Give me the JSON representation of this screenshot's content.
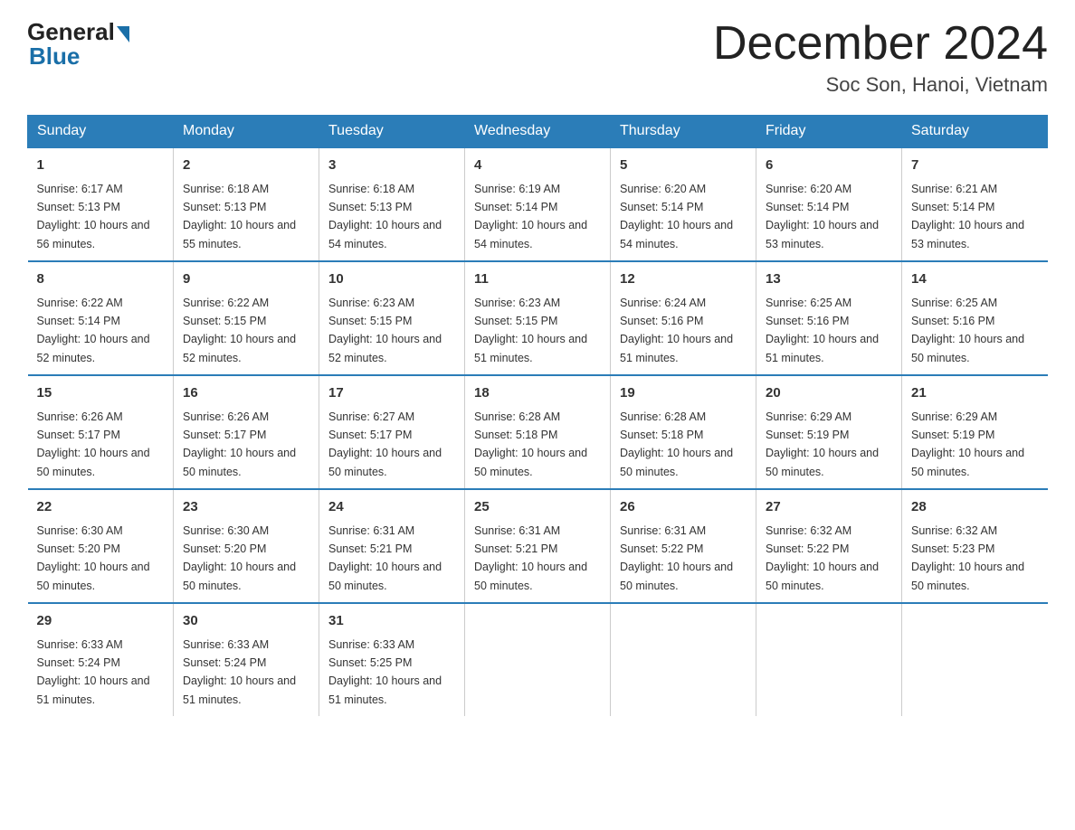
{
  "logo": {
    "general": "General",
    "blue": "Blue"
  },
  "title": "December 2024",
  "location": "Soc Son, Hanoi, Vietnam",
  "days_of_week": [
    "Sunday",
    "Monday",
    "Tuesday",
    "Wednesday",
    "Thursday",
    "Friday",
    "Saturday"
  ],
  "weeks": [
    [
      {
        "num": "1",
        "sunrise": "6:17 AM",
        "sunset": "5:13 PM",
        "daylight": "10 hours and 56 minutes."
      },
      {
        "num": "2",
        "sunrise": "6:18 AM",
        "sunset": "5:13 PM",
        "daylight": "10 hours and 55 minutes."
      },
      {
        "num": "3",
        "sunrise": "6:18 AM",
        "sunset": "5:13 PM",
        "daylight": "10 hours and 54 minutes."
      },
      {
        "num": "4",
        "sunrise": "6:19 AM",
        "sunset": "5:14 PM",
        "daylight": "10 hours and 54 minutes."
      },
      {
        "num": "5",
        "sunrise": "6:20 AM",
        "sunset": "5:14 PM",
        "daylight": "10 hours and 54 minutes."
      },
      {
        "num": "6",
        "sunrise": "6:20 AM",
        "sunset": "5:14 PM",
        "daylight": "10 hours and 53 minutes."
      },
      {
        "num": "7",
        "sunrise": "6:21 AM",
        "sunset": "5:14 PM",
        "daylight": "10 hours and 53 minutes."
      }
    ],
    [
      {
        "num": "8",
        "sunrise": "6:22 AM",
        "sunset": "5:14 PM",
        "daylight": "10 hours and 52 minutes."
      },
      {
        "num": "9",
        "sunrise": "6:22 AM",
        "sunset": "5:15 PM",
        "daylight": "10 hours and 52 minutes."
      },
      {
        "num": "10",
        "sunrise": "6:23 AM",
        "sunset": "5:15 PM",
        "daylight": "10 hours and 52 minutes."
      },
      {
        "num": "11",
        "sunrise": "6:23 AM",
        "sunset": "5:15 PM",
        "daylight": "10 hours and 51 minutes."
      },
      {
        "num": "12",
        "sunrise": "6:24 AM",
        "sunset": "5:16 PM",
        "daylight": "10 hours and 51 minutes."
      },
      {
        "num": "13",
        "sunrise": "6:25 AM",
        "sunset": "5:16 PM",
        "daylight": "10 hours and 51 minutes."
      },
      {
        "num": "14",
        "sunrise": "6:25 AM",
        "sunset": "5:16 PM",
        "daylight": "10 hours and 50 minutes."
      }
    ],
    [
      {
        "num": "15",
        "sunrise": "6:26 AM",
        "sunset": "5:17 PM",
        "daylight": "10 hours and 50 minutes."
      },
      {
        "num": "16",
        "sunrise": "6:26 AM",
        "sunset": "5:17 PM",
        "daylight": "10 hours and 50 minutes."
      },
      {
        "num": "17",
        "sunrise": "6:27 AM",
        "sunset": "5:17 PM",
        "daylight": "10 hours and 50 minutes."
      },
      {
        "num": "18",
        "sunrise": "6:28 AM",
        "sunset": "5:18 PM",
        "daylight": "10 hours and 50 minutes."
      },
      {
        "num": "19",
        "sunrise": "6:28 AM",
        "sunset": "5:18 PM",
        "daylight": "10 hours and 50 minutes."
      },
      {
        "num": "20",
        "sunrise": "6:29 AM",
        "sunset": "5:19 PM",
        "daylight": "10 hours and 50 minutes."
      },
      {
        "num": "21",
        "sunrise": "6:29 AM",
        "sunset": "5:19 PM",
        "daylight": "10 hours and 50 minutes."
      }
    ],
    [
      {
        "num": "22",
        "sunrise": "6:30 AM",
        "sunset": "5:20 PM",
        "daylight": "10 hours and 50 minutes."
      },
      {
        "num": "23",
        "sunrise": "6:30 AM",
        "sunset": "5:20 PM",
        "daylight": "10 hours and 50 minutes."
      },
      {
        "num": "24",
        "sunrise": "6:31 AM",
        "sunset": "5:21 PM",
        "daylight": "10 hours and 50 minutes."
      },
      {
        "num": "25",
        "sunrise": "6:31 AM",
        "sunset": "5:21 PM",
        "daylight": "10 hours and 50 minutes."
      },
      {
        "num": "26",
        "sunrise": "6:31 AM",
        "sunset": "5:22 PM",
        "daylight": "10 hours and 50 minutes."
      },
      {
        "num": "27",
        "sunrise": "6:32 AM",
        "sunset": "5:22 PM",
        "daylight": "10 hours and 50 minutes."
      },
      {
        "num": "28",
        "sunrise": "6:32 AM",
        "sunset": "5:23 PM",
        "daylight": "10 hours and 50 minutes."
      }
    ],
    [
      {
        "num": "29",
        "sunrise": "6:33 AM",
        "sunset": "5:24 PM",
        "daylight": "10 hours and 51 minutes."
      },
      {
        "num": "30",
        "sunrise": "6:33 AM",
        "sunset": "5:24 PM",
        "daylight": "10 hours and 51 minutes."
      },
      {
        "num": "31",
        "sunrise": "6:33 AM",
        "sunset": "5:25 PM",
        "daylight": "10 hours and 51 minutes."
      },
      null,
      null,
      null,
      null
    ]
  ],
  "labels": {
    "sunrise_prefix": "Sunrise: ",
    "sunset_prefix": "Sunset: ",
    "daylight_prefix": "Daylight: "
  }
}
